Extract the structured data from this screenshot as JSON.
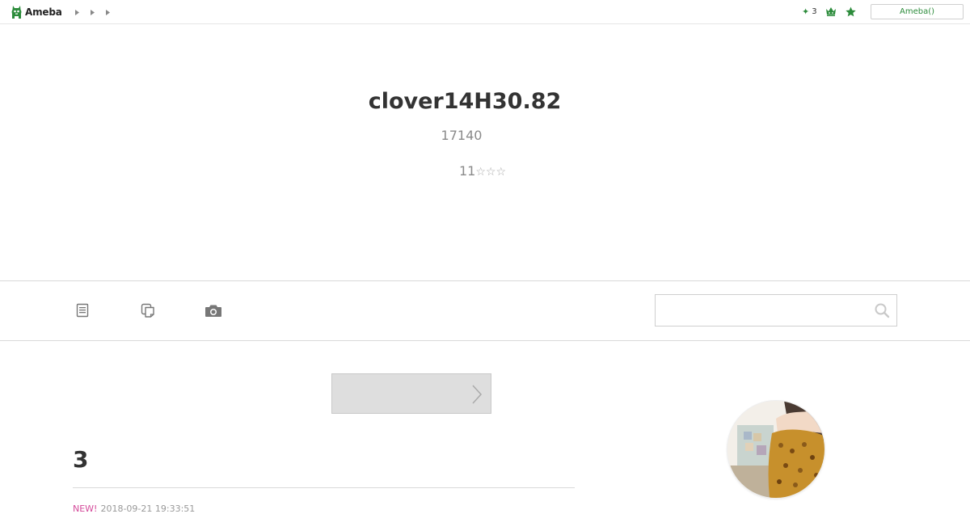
{
  "topbar": {
    "brand": "Ameba",
    "notifications_count": "3",
    "account_button": "Ameba()",
    "icons": [
      "ameba-logo-icon",
      "caret-right-icon",
      "crown-icon",
      "star-icon"
    ],
    "accent": "#2d8c3c"
  },
  "header": {
    "title": "clover14H30.82",
    "subtitle": "17140",
    "rank_number": "11",
    "rank_stars": "☆☆☆"
  },
  "nav": {
    "tabs": [
      {
        "icon": "document-icon"
      },
      {
        "icon": "copy-icon"
      },
      {
        "icon": "camera-icon"
      }
    ],
    "search": {
      "value": "",
      "placeholder": ""
    }
  },
  "content": {
    "entry_title": "3",
    "entry_badge": "NEW!",
    "entry_date": "2018-09-21 19:33:51"
  },
  "colors": {
    "new_badge": "#d44a9a",
    "brand_green": "#2d8c3c"
  }
}
